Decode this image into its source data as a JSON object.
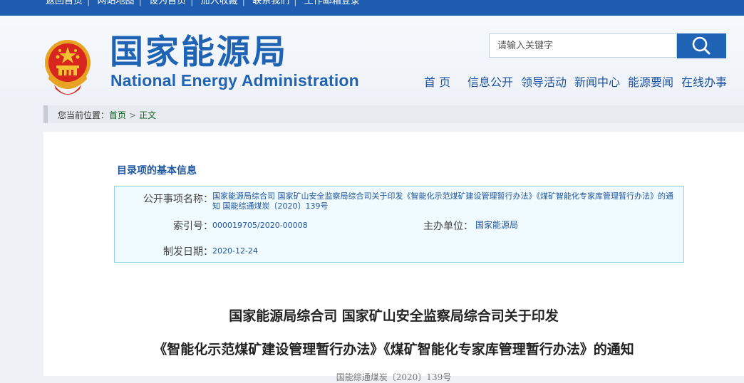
{
  "topbar": {
    "links": [
      "返回首页",
      "网站地图",
      "设为首页",
      "加入收藏",
      "联系我们",
      "工作邮箱登录"
    ]
  },
  "header": {
    "title_cn": "国家能源局",
    "title_en": "National Energy Administration"
  },
  "search": {
    "placeholder": "请输入关键字",
    "button_icon": "search-icon"
  },
  "nav": {
    "items": [
      "首 页",
      "信息公开",
      "领导活动",
      "新闻中心",
      "能源要闻",
      "在线办事"
    ]
  },
  "breadcrumb": {
    "prefix": "您当前位置：",
    "home": "首页",
    "separator": ">",
    "current": "正文"
  },
  "info": {
    "section_title": "目录项的基本信息",
    "name_label": "公开事项名称：",
    "name_value": "国家能源局综合司 国家矿山安全监察局综合司关于印发《智能化示范煤矿建设管理暂行办法》《煤矿智能化专家库管理暂行办法》的通知 国能综通煤炭〔2020〕139号",
    "index_label": "索引号：",
    "index_value": "000019705/2020-00008",
    "org_label": "主办单位：",
    "org_value": "国家能源局",
    "date_label": "制发日期：",
    "date_value": "2020-12-24"
  },
  "document": {
    "title_line1": "国家能源局综合司 国家矿山安全监察局综合司关于印发",
    "title_line2": "《智能化示范煤矿建设管理暂行办法》《煤矿智能化专家库管理暂行办法》的通知",
    "doc_number": "国能综通煤炭〔2020〕139号"
  },
  "colors": {
    "brand_blue": "#1f64b4",
    "topbar_blue": "#1d5caf",
    "info_border": "#8fd3e8",
    "info_bg": "#f0fbff"
  }
}
